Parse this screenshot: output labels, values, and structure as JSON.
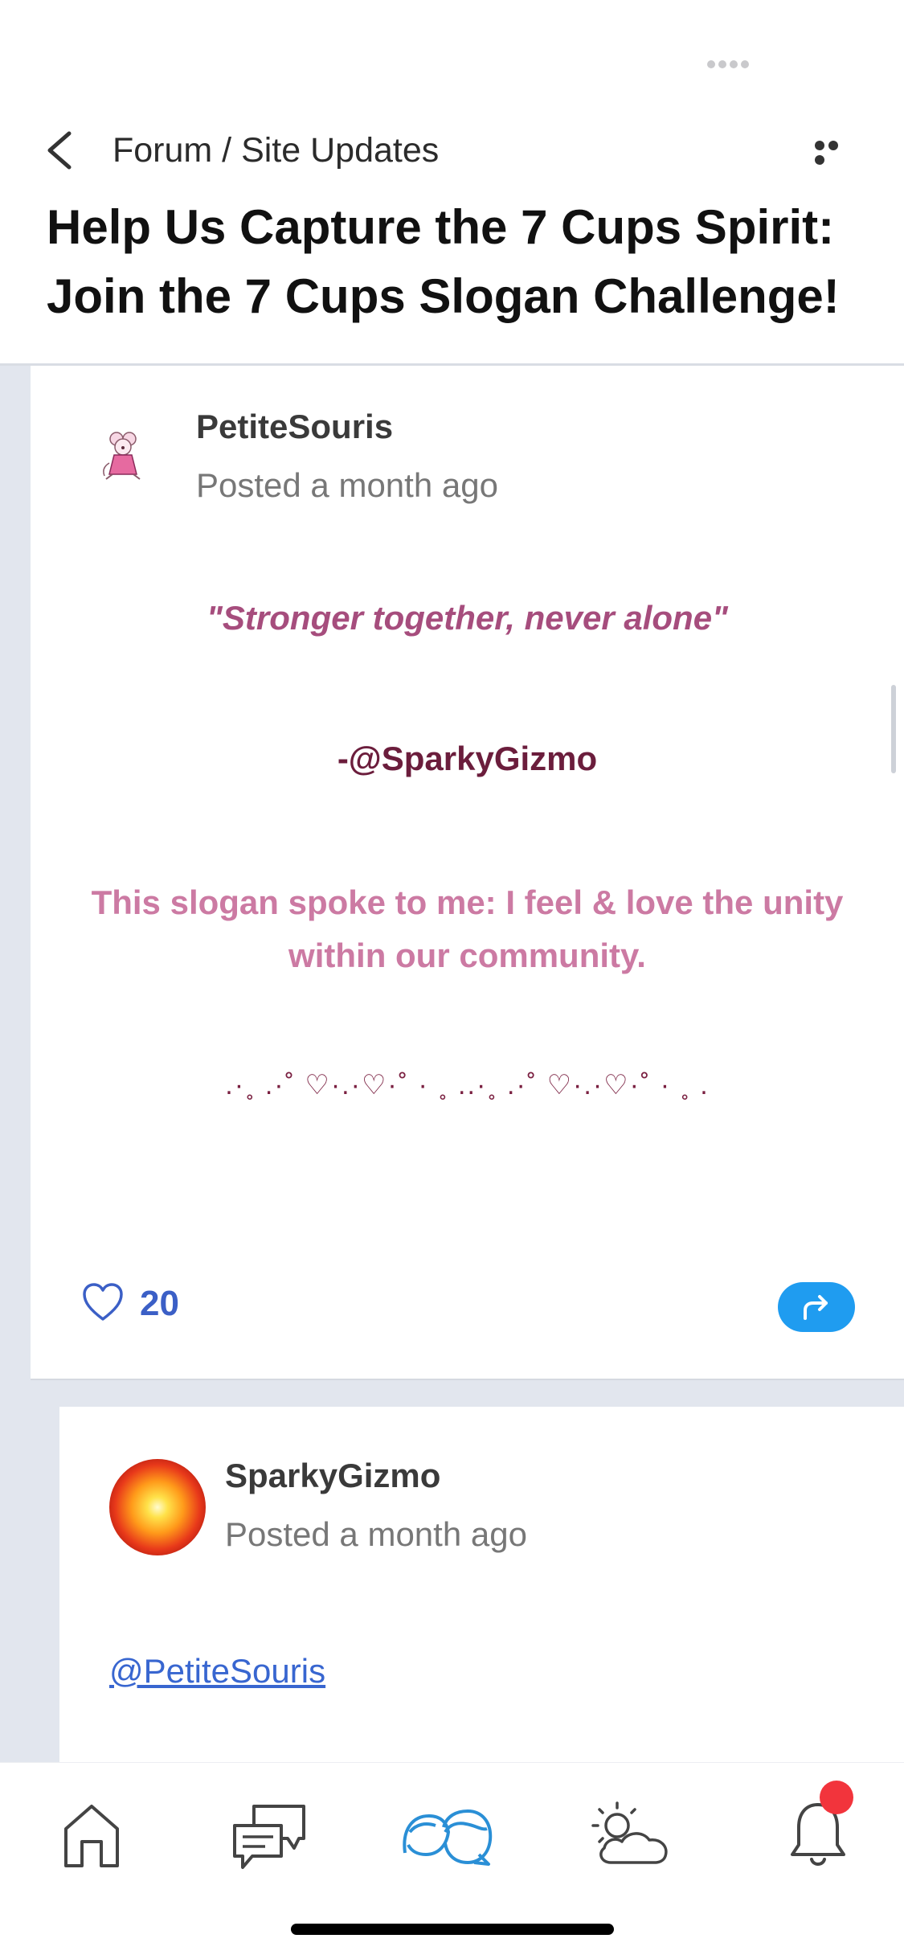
{
  "header": {
    "breadcrumb": "Forum / Site Updates",
    "title": "Help Us Capture the 7 Cups Spirit: Join the 7 Cups Slogan Challenge!"
  },
  "posts": [
    {
      "author": "PetiteSouris",
      "posted": "Posted a month ago",
      "slogan": "\"Stronger together, never alone\"",
      "credit": "-@SparkyGizmo",
      "reason": "This slogan spoke to me: I feel & love the unity within our community.",
      "decoration": ".·˳  .·˚  ♡·.·♡·˚   ·  ˳  ..·˳   .·˚  ♡·.·♡·˚   ·  ˳  .",
      "likes": "20"
    },
    {
      "author": "SparkyGizmo",
      "posted": "Posted a month ago",
      "mention": "@PetiteSouris"
    }
  ],
  "nav": {
    "items": [
      "home-icon",
      "chat-icon",
      "community-icon",
      "weather-icon",
      "bell-icon"
    ],
    "active": "community-icon",
    "accent": "#2a8fd6"
  },
  "colors": {
    "slogan": "#a64d7d",
    "credit": "#6b1d3c",
    "reason": "#cc7aa3",
    "like": "#3b5fc6",
    "share": "#1f9cf0",
    "badge": "#f2343c"
  }
}
